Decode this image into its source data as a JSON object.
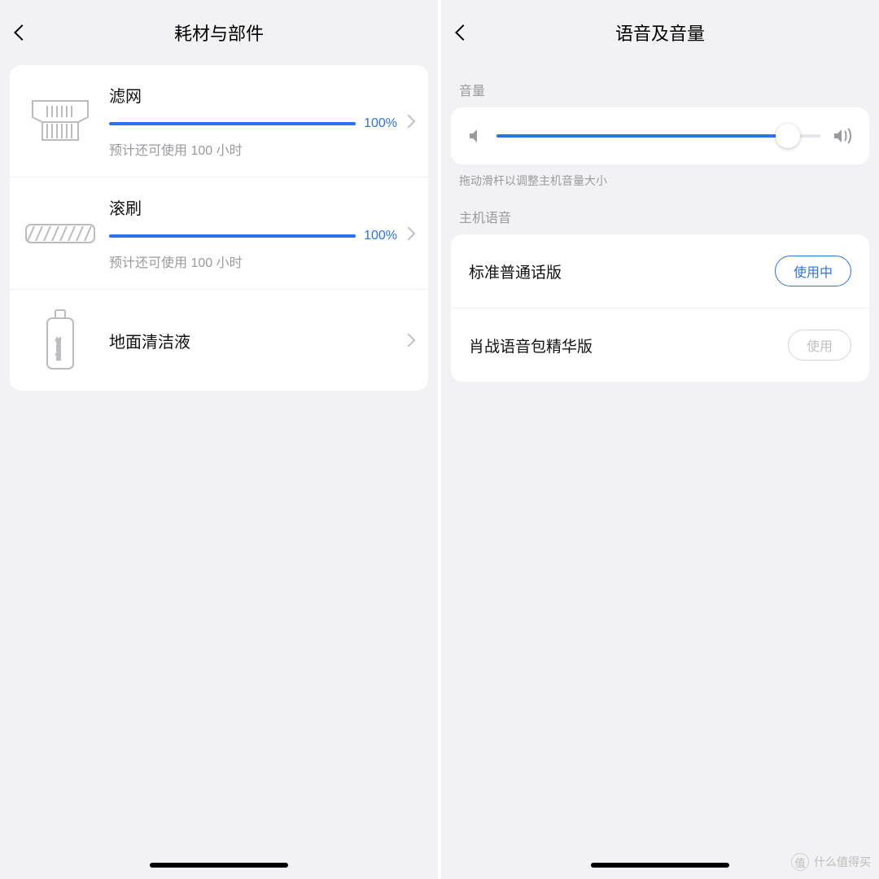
{
  "left": {
    "title": "耗材与部件",
    "items": [
      {
        "name": "滤网",
        "percent": 100,
        "percent_text": "100%",
        "sub": "预计还可使用 100 小时",
        "icon": "filter-icon"
      },
      {
        "name": "滚刷",
        "percent": 100,
        "percent_text": "100%",
        "sub": "预计还可使用 100 小时",
        "icon": "brush-icon"
      },
      {
        "name": "地面清洁液",
        "icon": "liquid-icon"
      }
    ]
  },
  "right": {
    "title": "语音及音量",
    "volume_label": "音量",
    "volume_percent": 90,
    "volume_hint": "拖动滑杆以调整主机音量大小",
    "voice_label": "主机语音",
    "voices": [
      {
        "name": "标准普通话版",
        "button": "使用中",
        "active": true
      },
      {
        "name": "肖战语音包精华版",
        "button": "使用",
        "active": false
      }
    ]
  },
  "watermark": {
    "logo": "值",
    "text": "什么值得买"
  }
}
